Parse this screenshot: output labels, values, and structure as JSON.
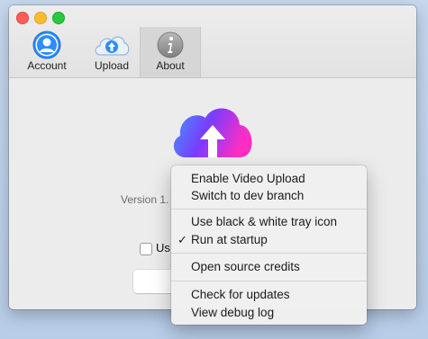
{
  "tabs": [
    {
      "label": "Account",
      "icon": "account-icon"
    },
    {
      "label": "Upload",
      "icon": "upload-icon"
    },
    {
      "label": "About",
      "icon": "info-icon",
      "selected": true
    }
  ],
  "about": {
    "version_text": "Version 1.",
    "checkbox_label_partial": "Us"
  },
  "context_menu": {
    "groups": [
      [
        {
          "label": "Enable Video Upload",
          "checked": false
        },
        {
          "label": "Switch to dev branch",
          "checked": false
        }
      ],
      [
        {
          "label": "Use black & white tray icon",
          "checked": false
        },
        {
          "label": "Run at startup",
          "checked": true
        }
      ],
      [
        {
          "label": "Open source credits",
          "checked": false
        }
      ],
      [
        {
          "label": "Check for updates",
          "checked": false
        },
        {
          "label": "View debug log",
          "checked": false
        }
      ]
    ],
    "check_glyph": "✓"
  },
  "colors": {
    "accent_blue": "#2d8cff",
    "logo_gradient": [
      "#3f9bff",
      "#7a3cff",
      "#ff2ec3"
    ]
  }
}
